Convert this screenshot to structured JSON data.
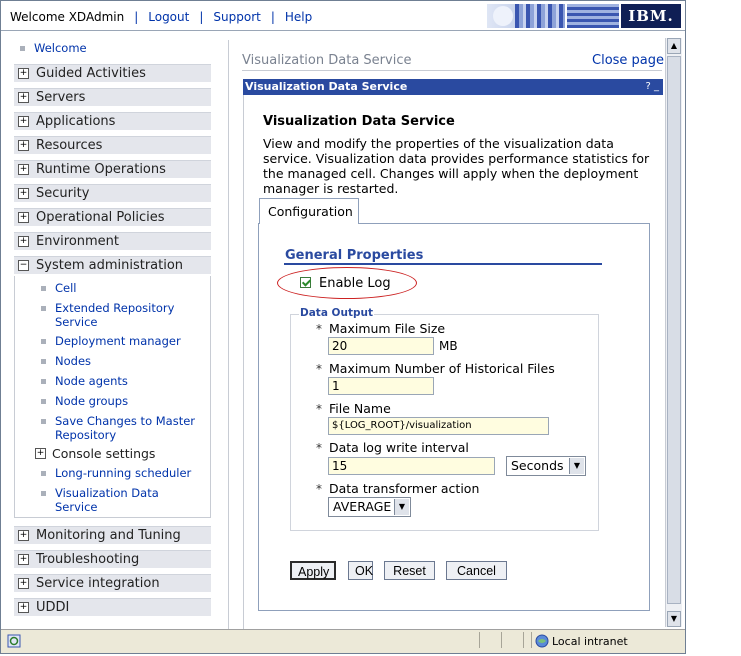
{
  "topbar": {
    "welcome": "Welcome XDAdmin",
    "logout": "Logout",
    "support": "Support",
    "help": "Help",
    "logo": "IBM."
  },
  "nav": {
    "welcome": "Welcome",
    "items": [
      {
        "label": "Guided Activities",
        "state": "+"
      },
      {
        "label": "Servers",
        "state": "+"
      },
      {
        "label": "Applications",
        "state": "+"
      },
      {
        "label": "Resources",
        "state": "+"
      },
      {
        "label": "Runtime Operations",
        "state": "+"
      },
      {
        "label": "Security",
        "state": "+"
      },
      {
        "label": "Operational Policies",
        "state": "+"
      },
      {
        "label": "Environment",
        "state": "+"
      },
      {
        "label": "System administration",
        "state": "−"
      }
    ],
    "sysadmin_children": {
      "cell": "Cell",
      "ext_repo": "Extended Repository Service",
      "dep_mgr": "Deployment manager",
      "nodes": "Nodes",
      "node_agents": "Node agents",
      "node_groups": "Node groups",
      "save_changes": "Save Changes to Master Repository",
      "console_settings": "Console settings",
      "long_running": "Long-running scheduler",
      "viz_data": "Visualization Data Service"
    },
    "bottom_items": [
      {
        "label": "Monitoring and Tuning",
        "state": "+"
      },
      {
        "label": "Troubleshooting",
        "state": "+"
      },
      {
        "label": "Service integration",
        "state": "+"
      },
      {
        "label": "UDDI",
        "state": "+"
      }
    ]
  },
  "content": {
    "breadcrumb": "Visualization Data Service",
    "close_page": "Close page",
    "titlebar": "Visualization Data Service",
    "titlebar_icons": "? _",
    "heading": "Visualization Data Service",
    "description": "View and modify the properties of the visualization data service. Visualization data provides performance statistics for the managed cell. Changes will apply when the deployment manager is restarted.",
    "tab": "Configuration",
    "general_properties": "General Properties",
    "enable_log": "Enable Log",
    "enable_log_checked": true,
    "data_output_legend": "Data Output",
    "required_marker": "*",
    "max_file_size_label": "Maximum File Size",
    "max_file_size_value": "20",
    "max_file_size_unit": "MB",
    "max_hist_label": "Maximum Number of Historical Files",
    "max_hist_value": "1",
    "file_name_label": "File Name",
    "file_name_value": "${LOG_ROOT}/visualization",
    "interval_label": "Data log write interval",
    "interval_value": "15",
    "interval_unit": "Seconds",
    "transformer_label": "Data transformer action",
    "transformer_value": "AVERAGE",
    "buttons": {
      "apply": "Apply",
      "ok": "OK",
      "reset": "Reset",
      "cancel": "Cancel"
    }
  },
  "status": {
    "zone": "Local intranet"
  },
  "colors": {
    "titlebar": "#2a4aa0",
    "link": "#0033aa",
    "highlight_ellipse": "#cc2222",
    "input_bg": "#fffde0"
  }
}
